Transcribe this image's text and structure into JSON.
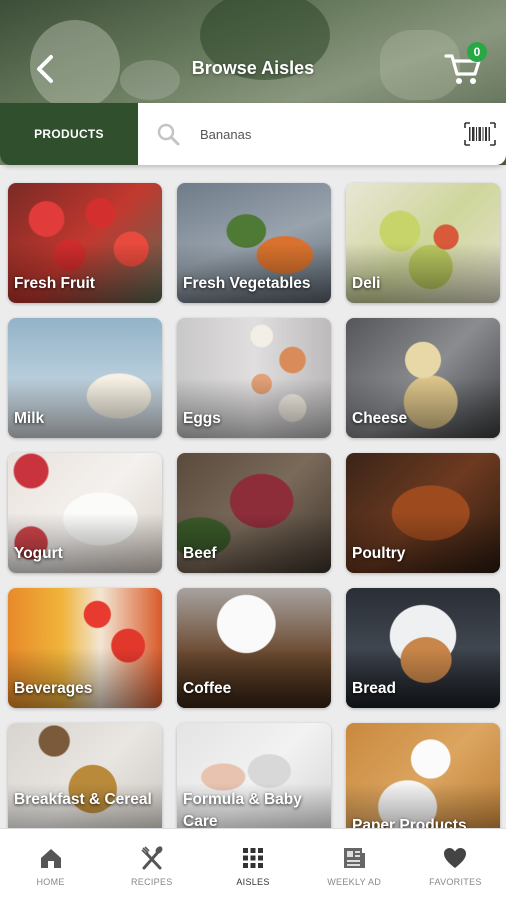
{
  "header": {
    "title": "Browse Aisles",
    "cart_count": "0"
  },
  "search": {
    "tab_label": "PRODUCTS",
    "value": "Bananas"
  },
  "aisles": [
    {
      "label": "Fresh Fruit"
    },
    {
      "label": "Fresh Vegetables"
    },
    {
      "label": "Deli"
    },
    {
      "label": "Milk"
    },
    {
      "label": "Eggs"
    },
    {
      "label": "Cheese"
    },
    {
      "label": "Yogurt"
    },
    {
      "label": "Beef"
    },
    {
      "label": "Poultry"
    },
    {
      "label": "Beverages"
    },
    {
      "label": "Coffee"
    },
    {
      "label": "Bread"
    },
    {
      "label": "Breakfast & Cereal"
    },
    {
      "label": "Formula & Baby Care"
    },
    {
      "label": "Paper Products"
    }
  ],
  "nav": {
    "items": [
      {
        "label": "HOME",
        "icon": "home-icon"
      },
      {
        "label": "RECIPES",
        "icon": "utensils-icon"
      },
      {
        "label": "AISLES",
        "icon": "grid-icon"
      },
      {
        "label": "WEEKLY AD",
        "icon": "newspaper-icon"
      },
      {
        "label": "FAVORITES",
        "icon": "heart-icon"
      }
    ],
    "active": "AISLES"
  },
  "colors": {
    "brand_green": "#2f4f2d",
    "badge_green": "#27a844"
  }
}
